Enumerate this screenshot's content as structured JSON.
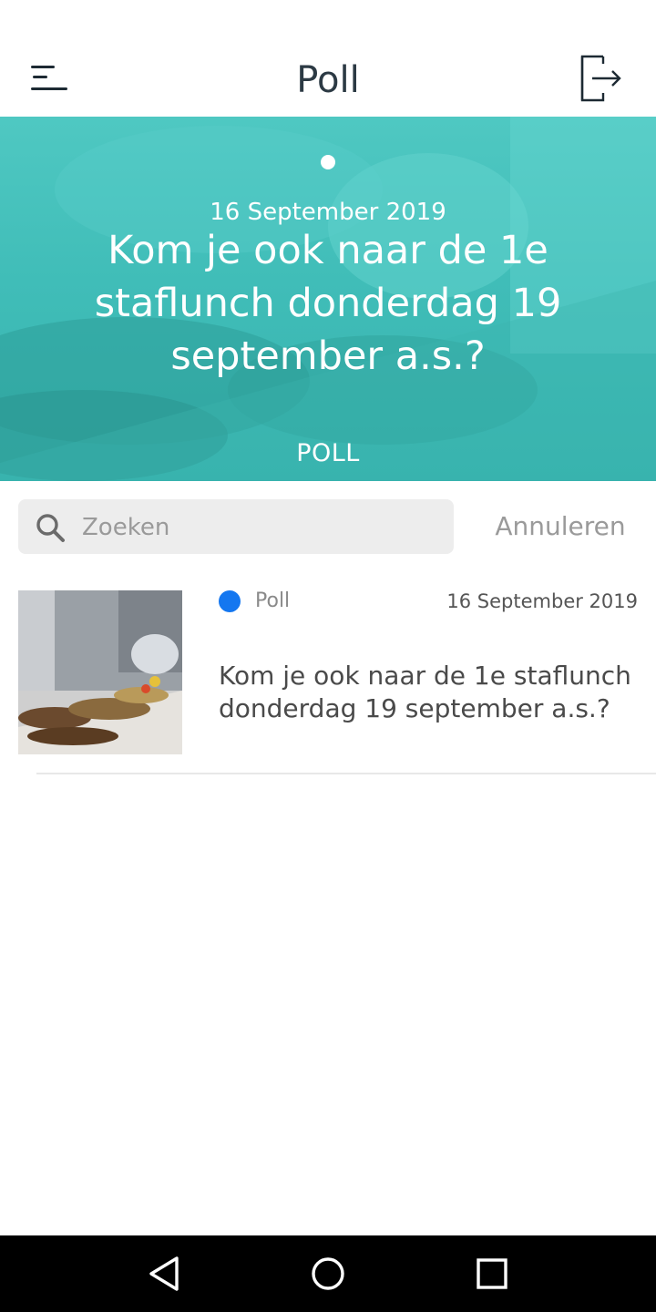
{
  "header": {
    "title": "Poll",
    "menu_icon": "menu-icon",
    "logout_icon": "logout-icon"
  },
  "hero": {
    "date": "16 September 2019",
    "title": "Kom je ook naar de 1e staflunch donderdag 19 september a.s.?",
    "category": "POLL",
    "overlay_color": "#40bdb8"
  },
  "search": {
    "placeholder": "Zoeken",
    "value": "",
    "cancel_label": "Annuleren"
  },
  "items": [
    {
      "category": "Poll",
      "category_color": "#1477f0",
      "date": "16 September 2019",
      "title": "Kom je ook naar de 1e staflunch donderdag 19 september a.s.?"
    }
  ],
  "navbar": {
    "back_icon": "back-triangle-icon",
    "home_icon": "home-circle-icon",
    "recents_icon": "recents-square-icon"
  }
}
